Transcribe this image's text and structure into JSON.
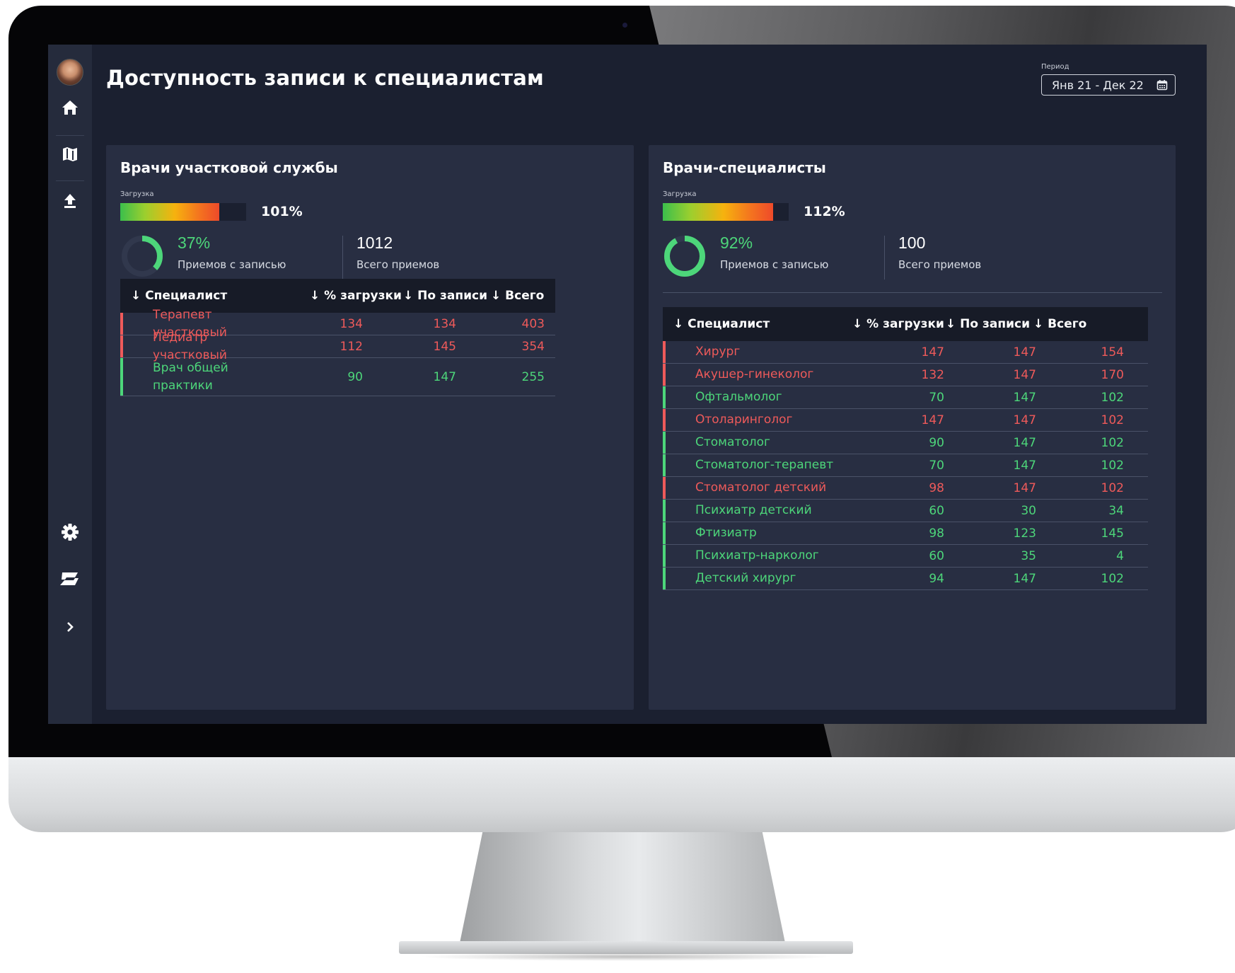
{
  "app": {
    "title": "Доступность записи к специалистам",
    "period_label": "Период",
    "period_value": "Янв 21 - Дек 22"
  },
  "sidebar": {
    "items": [
      {
        "icon": "home-icon"
      },
      {
        "icon": "map-icon"
      },
      {
        "icon": "upload-icon"
      },
      {
        "icon": "gear-icon"
      },
      {
        "icon": "logo-icon"
      },
      {
        "icon": "chevron-right-icon"
      }
    ]
  },
  "colors": {
    "over_capacity": "#ee5a5a",
    "within_capacity": "#4dd67a"
  },
  "panels": {
    "district": {
      "title": "Врачи участковой службы",
      "load_label": "Загрузка",
      "load_value": 101,
      "load_text": "101%",
      "booked_share": 37,
      "booked_pct_text": "37%",
      "booked_label": "Приемов с записью",
      "total_value": "1012",
      "total_label": "Всего приемов",
      "columns": [
        "↓ Специалист",
        "↓ % загрузки",
        "↓ По записи",
        "↓ Всего"
      ],
      "rows": [
        {
          "name": "Терапевт участковый",
          "load": "134",
          "booked": "134",
          "total": "403",
          "status": "over"
        },
        {
          "name": "Педиатр участковый",
          "load": "112",
          "booked": "145",
          "total": "354",
          "status": "over"
        },
        {
          "name": "Врач общей практики",
          "load": "90",
          "booked": "147",
          "total": "255",
          "status": "ok"
        }
      ]
    },
    "specialists": {
      "title": "Врачи-специалисты",
      "load_label": "Загрузка",
      "load_value": 112,
      "load_text": "112%",
      "booked_share": 92,
      "booked_pct_text": "92%",
      "booked_label": "Приемов с записью",
      "total_value": "100",
      "total_label": "Всего приемов",
      "columns": [
        "↓ Специалист",
        "↓ % загрузки",
        "↓ По записи",
        "↓ Всего"
      ],
      "rows": [
        {
          "name": "Хирург",
          "load": "147",
          "booked": "147",
          "total": "154",
          "status": "over"
        },
        {
          "name": "Акушер-гинеколог",
          "load": "132",
          "booked": "147",
          "total": "170",
          "status": "over"
        },
        {
          "name": "Офтальмолог",
          "load": "70",
          "booked": "147",
          "total": "102",
          "status": "ok"
        },
        {
          "name": "Отоларинголог",
          "load": "147",
          "booked": "147",
          "total": "102",
          "status": "over"
        },
        {
          "name": "Стоматолог",
          "load": "90",
          "booked": "147",
          "total": "102",
          "status": "ok"
        },
        {
          "name": "Стоматолог-терапевт",
          "load": "70",
          "booked": "147",
          "total": "102",
          "status": "ok"
        },
        {
          "name": "Стоматолог детский",
          "load": "98",
          "booked": "147",
          "total": "102",
          "status": "over"
        },
        {
          "name": "Психиатр детский",
          "load": "60",
          "booked": "30",
          "total": "34",
          "status": "ok"
        },
        {
          "name": "Фтизиатр",
          "load": "98",
          "booked": "123",
          "total": "145",
          "status": "ok"
        },
        {
          "name": "Психиатр-нарколог",
          "load": "60",
          "booked": "35",
          "total": "4",
          "status": "ok"
        },
        {
          "name": "Детский хирург",
          "load": "94",
          "booked": "147",
          "total": "102",
          "status": "ok"
        }
      ]
    }
  }
}
